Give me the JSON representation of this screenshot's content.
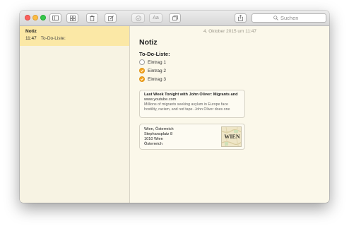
{
  "search": {
    "placeholder": "Suchen"
  },
  "sidebar": {
    "notes": [
      {
        "title": "Notiz",
        "time": "11:47",
        "preview": "To-Do-Liste:"
      }
    ]
  },
  "note": {
    "date": "4. Oktober 2015 um 11:47",
    "title": "Notiz",
    "checklist_heading": "To-Do-Liste:",
    "items": [
      {
        "label": "Eintrag 1",
        "checked": false
      },
      {
        "label": "Eintrag 2",
        "checked": true
      },
      {
        "label": "Eintrag 3",
        "checked": true
      }
    ],
    "link_card": {
      "title": "Last Week Tonight with John Oliver: Migrants and",
      "url": "www.youtube.com",
      "desc_line1": "Millions of migrants seeking asylum in Europe face",
      "desc_line2": "hostility, racism, and red tape. John Oliver does one"
    },
    "location_card": {
      "line1": "Wien, Österreich",
      "line2": "Stephansplatz 8",
      "line3": "1010 Wien",
      "line4": "Österreich",
      "map_label": "WIEN"
    }
  },
  "colors": {
    "accent": "#f5a623",
    "selected_note": "#fbe8a6",
    "paper": "#fbf8ea"
  },
  "icons": {
    "toolbar": [
      "sidebar-toggle-icon",
      "gallery-icon",
      "trash-icon",
      "compose-icon",
      "checklist-icon",
      "format-icon",
      "attachments-icon",
      "share-icon"
    ],
    "search": "search-icon"
  }
}
